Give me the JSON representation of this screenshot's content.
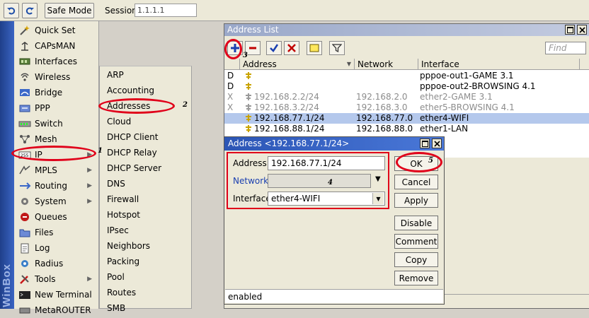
{
  "toolbar": {
    "safe_mode_label": "Safe Mode",
    "session_label": "Session:",
    "session_value": "1.1.1.1"
  },
  "sidebar": {
    "brand": "WinBox",
    "items": [
      {
        "label": "Quick Set",
        "icon": "wand-icon"
      },
      {
        "label": "CAPsMAN",
        "icon": "capsman-icon"
      },
      {
        "label": "Interfaces",
        "icon": "interfaces-icon"
      },
      {
        "label": "Wireless",
        "icon": "wireless-icon"
      },
      {
        "label": "Bridge",
        "icon": "bridge-icon"
      },
      {
        "label": "PPP",
        "icon": "ppp-icon"
      },
      {
        "label": "Switch",
        "icon": "switch-icon"
      },
      {
        "label": "Mesh",
        "icon": "mesh-icon"
      },
      {
        "label": "IP",
        "icon": "ip-icon"
      },
      {
        "label": "MPLS",
        "icon": "mpls-icon"
      },
      {
        "label": "Routing",
        "icon": "routing-icon"
      },
      {
        "label": "System",
        "icon": "system-gear-icon"
      },
      {
        "label": "Queues",
        "icon": "queues-icon"
      },
      {
        "label": "Files",
        "icon": "folder-icon"
      },
      {
        "label": "Log",
        "icon": "log-icon"
      },
      {
        "label": "Radius",
        "icon": "radius-icon"
      },
      {
        "label": "Tools",
        "icon": "tools-icon"
      },
      {
        "label": "New Terminal",
        "icon": "terminal-icon"
      },
      {
        "label": "MetaROUTER",
        "icon": "metarouter-icon"
      }
    ]
  },
  "ip_submenu": {
    "items": [
      "ARP",
      "Accounting",
      "Addresses",
      "Cloud",
      "DHCP Client",
      "DHCP Relay",
      "DHCP Server",
      "DNS",
      "Firewall",
      "Hotspot",
      "IPsec",
      "Neighbors",
      "Packing",
      "Pool",
      "Routes",
      "SMB"
    ]
  },
  "address_list": {
    "title": "Address List",
    "find_placeholder": "Find",
    "columns": [
      "Address",
      "Network",
      "Interface"
    ],
    "rows": [
      {
        "flag": "D",
        "address": "",
        "network": "",
        "interface": "pppoe-out1-GAME 3.1",
        "state": "dynamic"
      },
      {
        "flag": "D",
        "address": "",
        "network": "",
        "interface": "pppoe-out2-BROWSING 4.1",
        "state": "dynamic"
      },
      {
        "flag": "X",
        "address": "192.168.2.2/24",
        "network": "192.168.2.0",
        "interface": "ether2-GAME 3.1",
        "state": "disabled"
      },
      {
        "flag": "X",
        "address": "192.168.3.2/24",
        "network": "192.168.3.0",
        "interface": "ether5-BROWSING 4.1",
        "state": "disabled"
      },
      {
        "flag": "",
        "address": "192.168.77.1/24",
        "network": "192.168.77.0",
        "interface": "ether4-WIFI",
        "state": "selected"
      },
      {
        "flag": "",
        "address": "192.168.88.1/24",
        "network": "192.168.88.0",
        "interface": "ether1-LAN",
        "state": "normal"
      }
    ]
  },
  "address_dialog": {
    "title": "Address <192.168.77.1/24>",
    "address_label": "Address:",
    "address_value": "192.168.77.1/24",
    "network_label": "Network:",
    "network_value": "",
    "interface_label": "Interface:",
    "interface_value": "ether4-WIFI",
    "buttons": {
      "ok": "OK",
      "cancel": "Cancel",
      "apply": "Apply",
      "disable": "Disable",
      "comment": "Comment",
      "copy": "Copy",
      "remove": "Remove"
    },
    "status": "enabled"
  },
  "annotations": {
    "step_ip": "1",
    "step_addresses": "2",
    "step_add": "3",
    "step_fields": "4",
    "step_ok": "5"
  },
  "colors": {
    "annotation_red": "#e0001a",
    "dialog_title_blue": "#2b55b5",
    "selected_row": "#b4c8ec",
    "winbox_strip": "#1f3f8a"
  }
}
